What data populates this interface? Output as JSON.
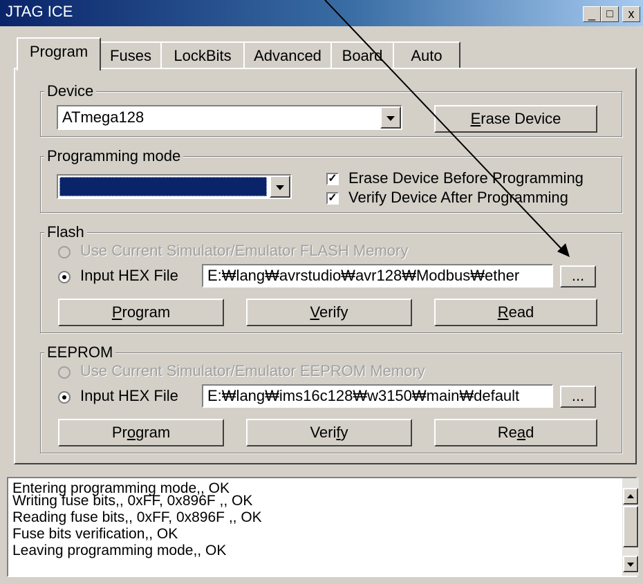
{
  "window": {
    "title": "JTAG ICE",
    "minimize": "_",
    "maximize": "□",
    "close": "x"
  },
  "tabs": [
    "Program",
    "Fuses",
    "LockBits",
    "Advanced",
    "Board",
    "Auto"
  ],
  "device": {
    "label": "Device",
    "value": "ATmega128",
    "erase_pre": "",
    "erase_key": "E",
    "erase_post": "rase Device"
  },
  "programming_mode": {
    "label": "Programming mode",
    "selected": "",
    "erase_before_label": "Erase Device Before Programming",
    "verify_after_label": "Verify Device After Programming",
    "erase_before_checked": true,
    "verify_after_checked": true
  },
  "flash": {
    "label": "Flash",
    "use_current_label": "Use Current Simulator/Emulator FLASH Memory",
    "input_hex_label": "Input HEX File",
    "path": "E:₩lang₩avrstudio₩avr128₩Modbus₩ether",
    "browse": "...",
    "program": {
      "pre": "",
      "key": "P",
      "post": "rogram"
    },
    "verify": {
      "pre": "",
      "key": "V",
      "post": "erify"
    },
    "read": {
      "pre": "",
      "key": "R",
      "post": "ead"
    }
  },
  "eeprom": {
    "label": "EEPROM",
    "use_current_label": "Use Current Simulator/Emulator EEPROM Memory",
    "input_hex_label": "Input HEX File",
    "path": "E:₩lang₩ims16c128₩w3150₩main₩default",
    "browse": "...",
    "program": {
      "pre": "Pr",
      "key": "o",
      "post": "gram"
    },
    "verify": {
      "pre": "Veri",
      "key": "f",
      "post": "y"
    },
    "read": {
      "pre": "Re",
      "key": "a",
      "post": "d"
    }
  },
  "log": [
    "Entering programming mode,, OK",
    "Writing fuse bits,, 0xFF, 0x896F ,, OK",
    "Reading fuse bits,, 0xFF, 0x896F ,, OK",
    "Fuse bits verification,, OK",
    "Leaving programming mode,, OK"
  ],
  "colors": {
    "title_bar": "#0a246a",
    "selection": "#0a246a",
    "face": "#d4d0c8"
  }
}
